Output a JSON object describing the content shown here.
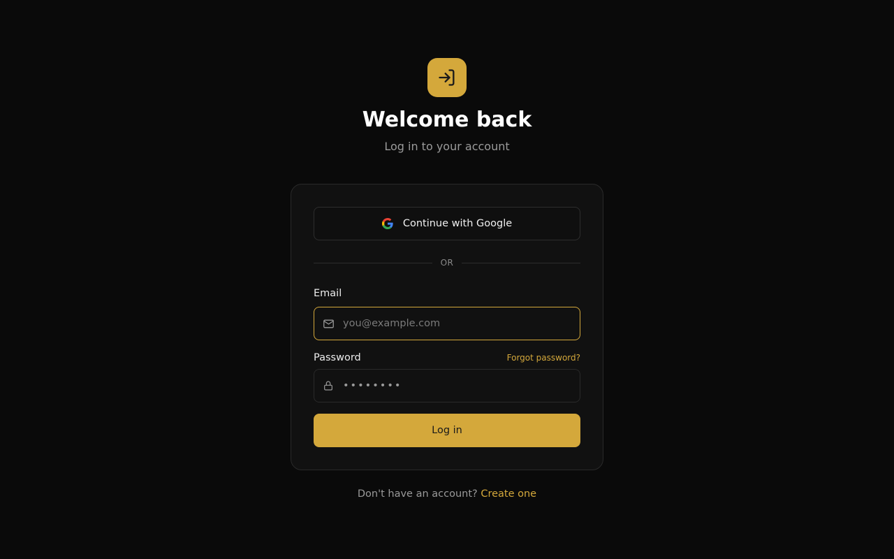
{
  "header": {
    "logo_icon": "login-arrow-icon",
    "title": "Welcome back",
    "subtitle": "Log in to your account"
  },
  "card": {
    "google_button": {
      "label": "Continue with Google",
      "icon": "google-icon"
    },
    "divider_text": "OR",
    "email": {
      "label": "Email",
      "placeholder": "you@example.com",
      "value": "",
      "icon": "mail-icon"
    },
    "password": {
      "label": "Password",
      "placeholder": "••••••••",
      "value": "",
      "icon": "lock-icon"
    },
    "forgot_password_link": "Forgot password?",
    "login_button": "Log in"
  },
  "footer": {
    "prompt": "Don't have an account?",
    "link": "Create one"
  },
  "colors": {
    "background": "#0a0a0a",
    "card": "#111111",
    "accent": "#d4a83b",
    "text_primary": "#ffffff",
    "text_muted": "#9a9a9a"
  }
}
